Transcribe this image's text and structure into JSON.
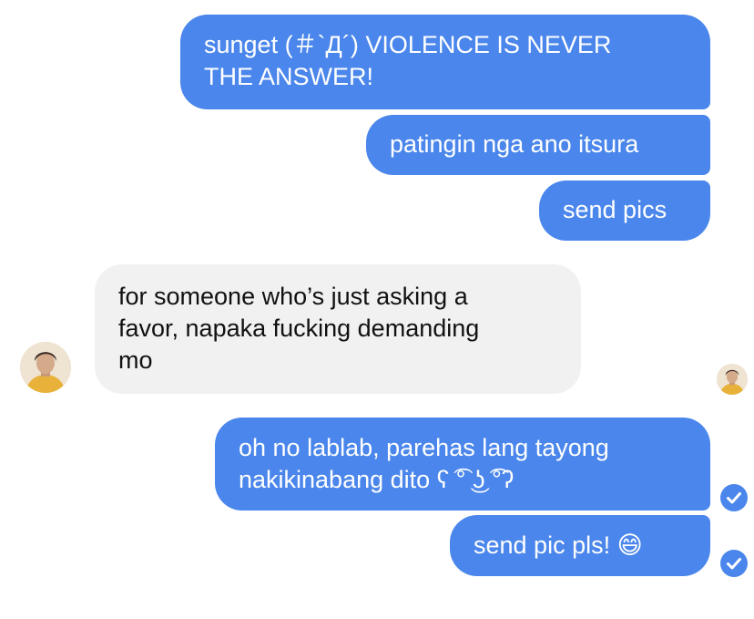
{
  "conversation": {
    "messages": [
      {
        "sender": "me",
        "text": "sunget (＃`Д´) VIOLENCE IS NEVER\nTHE ANSWER!"
      },
      {
        "sender": "me",
        "text": "patingin nga ano itsura"
      },
      {
        "sender": "me",
        "text": "send pics"
      },
      {
        "sender": "them",
        "text": "for someone who’s just asking a\nfavor, napaka fucking demanding\nmo"
      },
      {
        "sender": "me",
        "text": "oh no lablab, parehas lang tayong\nnakikinabang dito ʕ ͡° ͜ʖ ͡°ʔ"
      },
      {
        "sender": "me",
        "text": "send pic pls! 😄"
      }
    ]
  },
  "colors": {
    "outgoing_bubble": "#4a86eb",
    "incoming_bubble": "#f1f1f1",
    "delivered_check": "#4a86eb"
  },
  "icons": {
    "delivered": "check-circle-icon"
  }
}
